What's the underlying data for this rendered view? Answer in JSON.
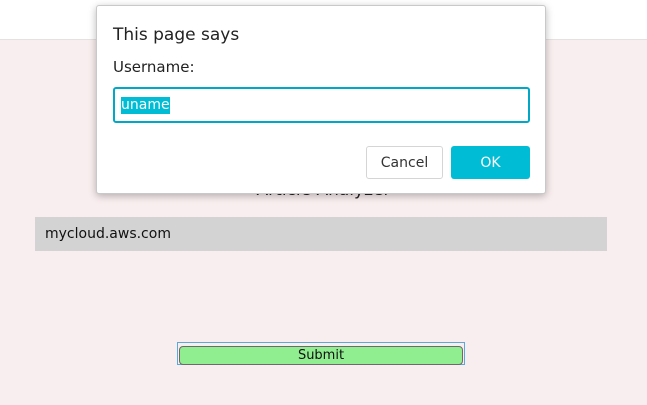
{
  "page": {
    "heading": "Article Analyzer",
    "url_value": "mycloud.aws.com",
    "submit_label": "Submit"
  },
  "dialog": {
    "title": "This page says",
    "label": "Username:",
    "input_value": "uname",
    "cancel_label": "Cancel",
    "ok_label": "OK"
  },
  "colors": {
    "page_background": "#f9eeef",
    "accent": "#00bcd4",
    "submit_button": "#90ee90",
    "input_field": "#d3d3d3"
  }
}
